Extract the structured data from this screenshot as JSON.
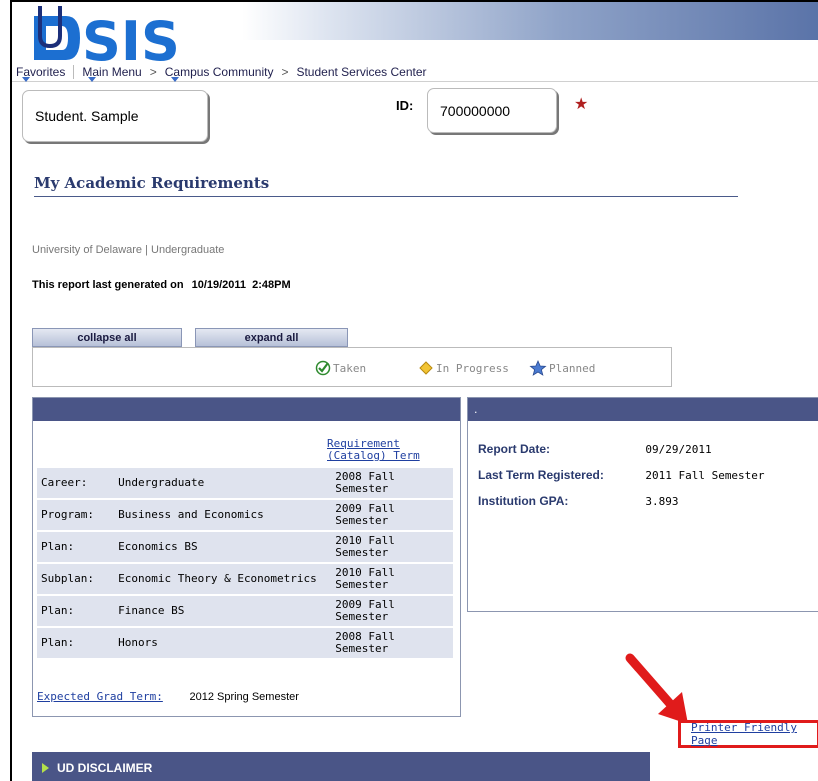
{
  "header": {
    "logo_text": "UDSIS"
  },
  "nav": {
    "favorites": "Favorites",
    "main_menu": "Main Menu",
    "campus": "Campus Community",
    "ssc": "Student Services Center",
    "separator": ">"
  },
  "student": {
    "name": "Student. Sample",
    "id_label": "ID:",
    "id": "700000000",
    "star": "★"
  },
  "page": {
    "title": "My Academic Requirements",
    "institution": "University of Delaware | Undergraduate",
    "report_generated_label": "This report last generated on",
    "report_generated_value": "10/19/2011  2:48PM"
  },
  "controls": {
    "collapse": "collapse all",
    "expand": "expand all"
  },
  "legend": {
    "taken": "Taken",
    "in_progress": "In Progress",
    "planned": "Planned"
  },
  "requirements": {
    "term_header": "Requirement (Catalog) Term",
    "rows": [
      {
        "label": "Career:",
        "value": "Undergraduate",
        "term": "2008 Fall Semester"
      },
      {
        "label": "Program:",
        "value": "Business and Economics",
        "term": "2009 Fall Semester"
      },
      {
        "label": "Plan:",
        "value": "Economics BS",
        "term": "2010 Fall Semester"
      },
      {
        "label": "Subplan:",
        "value": "Economic Theory & Econometrics",
        "term": "2010 Fall Semester"
      },
      {
        "label": "Plan:",
        "value": "Finance BS",
        "term": "2009 Fall Semester"
      },
      {
        "label": "Plan:",
        "value": "Honors",
        "term": "2008 Fall Semester"
      }
    ],
    "expected_label": "Expected Grad Term:",
    "expected_value": "2012 Spring Semester"
  },
  "report": {
    "header_text": ".",
    "report_date_label": "Report Date:",
    "report_date_value": "09/29/2011",
    "last_term_label": "Last Term Registered:",
    "last_term_value": "2011 Fall Semester",
    "gpa_label": "Institution GPA:",
    "gpa_value": "3.893"
  },
  "printer_link": "Printer Friendly Page",
  "disclaimer": "UD DISCLAIMER",
  "colors": {
    "panel_header": "#4a5587",
    "row_bg": "#dfe3ee",
    "highlight": "#e01b1b",
    "link": "#1f3fa0"
  }
}
